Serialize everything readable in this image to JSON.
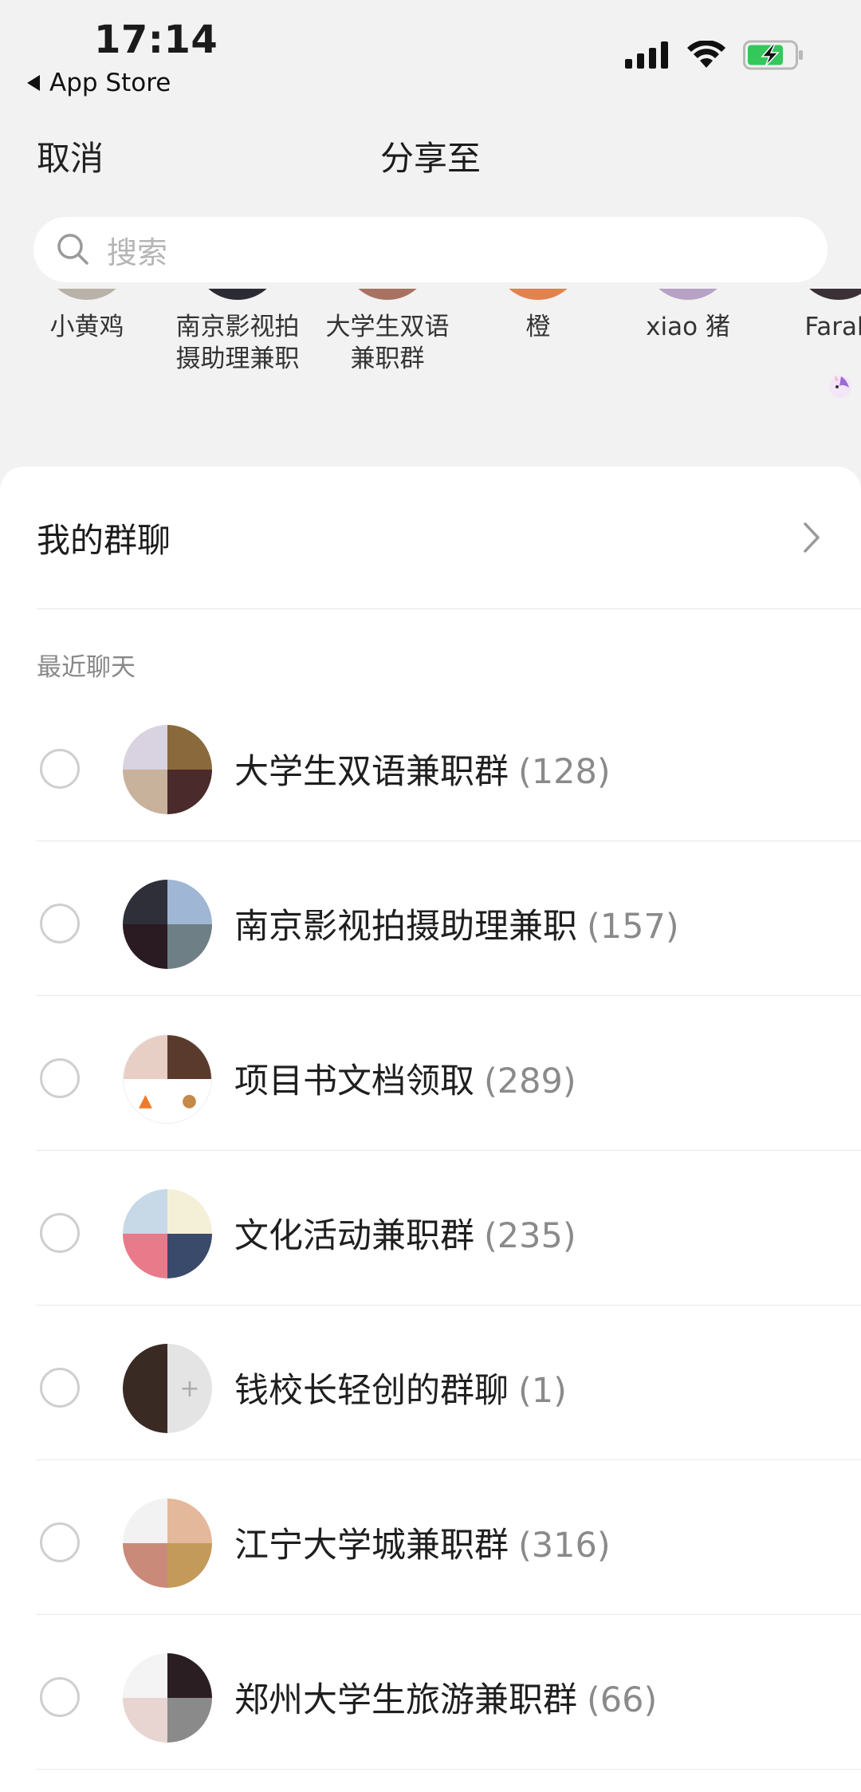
{
  "status": {
    "time": "17:14",
    "back_label": "App Store",
    "battery_color": "#34c759"
  },
  "nav": {
    "cancel_label": "取消",
    "title": "分享至"
  },
  "search": {
    "placeholder": "搜索"
  },
  "recent_contacts": [
    {
      "name": "小黄鸡"
    },
    {
      "name": "南京影视拍\n摄助理兼职"
    },
    {
      "name": "大学生双语\n兼职群"
    },
    {
      "name": "橙"
    },
    {
      "name": "xiao 猪"
    },
    {
      "name": "Farah"
    }
  ],
  "my_groups": {
    "label": "我的群聊"
  },
  "recent_section": {
    "label": "最近聊天"
  },
  "chats": [
    {
      "name": "大学生双语兼职群",
      "count": "(128)"
    },
    {
      "name": "南京影视拍摄助理兼职",
      "count": "(157)"
    },
    {
      "name": "项目书文档领取",
      "count": "(289)"
    },
    {
      "name": "文化活动兼职群",
      "count": "(235)"
    },
    {
      "name": "钱校长轻创的群聊",
      "count": "(1)"
    },
    {
      "name": "江宁大学城兼职群",
      "count": "(316)"
    },
    {
      "name": "郑州大学生旅游兼职群",
      "count": "(66)"
    }
  ]
}
